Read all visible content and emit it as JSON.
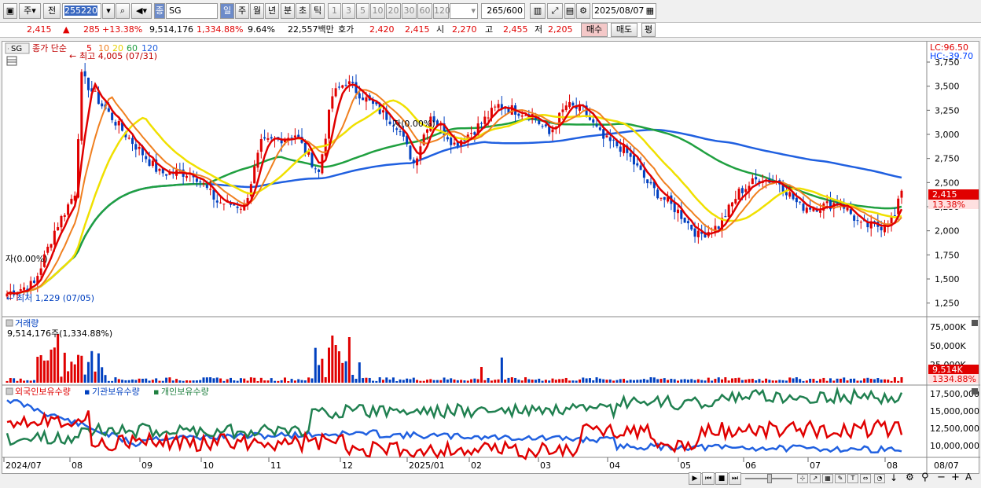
{
  "toolbar": {
    "market": "주",
    "prev_label": "전",
    "code": "255220",
    "name": "SG",
    "period_tabs": [
      "일",
      "주",
      "월",
      "년",
      "분",
      "초",
      "틱"
    ],
    "intervals": [
      "1",
      "3",
      "5",
      "10",
      "20",
      "30",
      "60",
      "120"
    ],
    "count": "265",
    "count_total": "/600",
    "date": "2025/08/07"
  },
  "info": {
    "price": "2,415",
    "change": "285",
    "change_pct": "+13.38%",
    "volume": "9,514,176",
    "volume_pct": "1,334.88%",
    "turnover": "9.64%",
    "amount": "22,557백만",
    "quote_label": "호가",
    "ask": "2,420",
    "bid": "2,415",
    "open_label": "시",
    "open": "2,270",
    "high_label": "고",
    "high": "2,455",
    "low_label": "저",
    "low": "2,205",
    "buy_label": "매수",
    "sell_label": "매도",
    "eval_label": "평"
  },
  "price_panel": {
    "symbol": "SG",
    "legend_prefix": "종가 단순",
    "ma_labels": [
      "5",
      "10",
      "20",
      "60",
      "120"
    ],
    "ma_colors": [
      "#e00000",
      "#f08020",
      "#f0e000",
      "#20a040",
      "#2060e0"
    ],
    "high_note": "최고 4,005 (07/31)",
    "low_note": "최저 1,229 (07/05)",
    "lc": "LC:96.50",
    "hc": "HC:-39.70",
    "mid_note": "자(0.00%)",
    "mid_note2": "자(0.00%)",
    "last_price": "2,415",
    "last_pct": "13.38%",
    "y_ticks": [
      "3,750",
      "3,500",
      "3,250",
      "3,000",
      "2,750",
      "2,500",
      "2,250",
      "2,000",
      "1,750",
      "1,500",
      "1,250"
    ]
  },
  "volume_panel": {
    "title": "거래량",
    "value": "9,514,176주(1,334.88%)",
    "y_ticks": [
      "75,000K",
      "50,000K",
      "25,000K"
    ],
    "last": "9,514K",
    "last_pct": "1334.88%"
  },
  "holding_panel": {
    "labels": [
      "외국인보유수량",
      "기관보유수량",
      "개인보유수량"
    ],
    "y_ticks": [
      "17,500,000",
      "15,000,000",
      "12,500,000",
      "10,000,000"
    ]
  },
  "x_axis": [
    "2024/07",
    "08",
    "09",
    "10",
    "11",
    "12",
    "2025/01",
    "02",
    "03",
    "04",
    "05",
    "06",
    "07",
    "08",
    "08/07"
  ]
}
